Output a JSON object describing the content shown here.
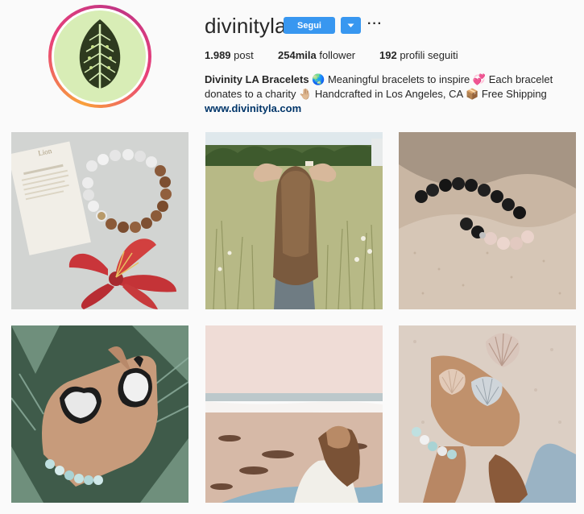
{
  "profile": {
    "username": "divinityla",
    "follow_label": "Segui",
    "more_label": "···",
    "stats": {
      "posts_value": "1.989",
      "posts_label": "post",
      "followers_value": "254mila",
      "followers_label": "follower",
      "following_value": "192",
      "following_label": "profili seguiti"
    },
    "bio_name": "Divinity LA Bracelets",
    "bio_text_1": " 🌏 Meaningful bracelets to inspire 💞 Each bracelet",
    "bio_text_2": "donates to a charity 🤚🏼 Handcrafted in Los Angeles, CA 📦 Free Shipping",
    "website": "www.divinityla.com"
  },
  "posts": [
    {
      "caption_card_title": "Lion"
    },
    {},
    {},
    {},
    {},
    {}
  ],
  "colors": {
    "accent": "#3897f0",
    "link": "#003569"
  }
}
